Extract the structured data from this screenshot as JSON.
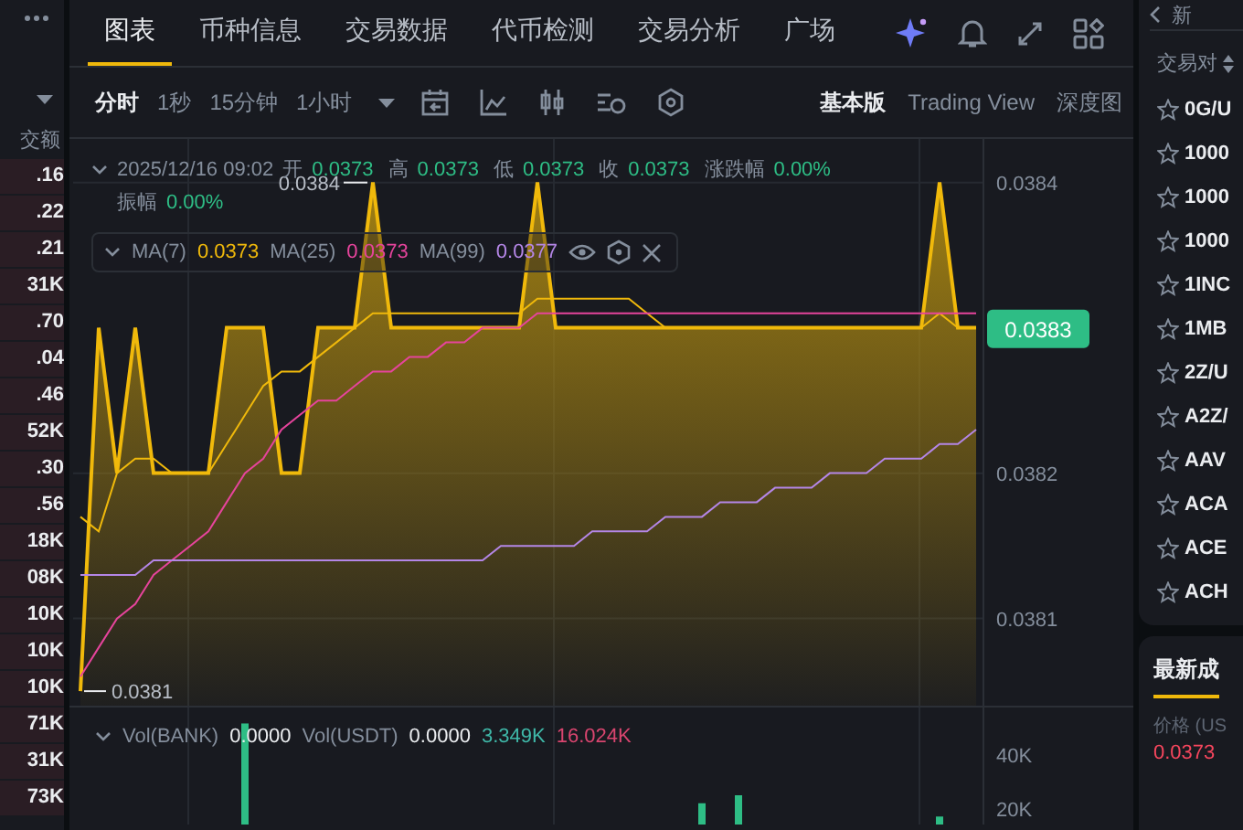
{
  "left_panel": {
    "header": "交额",
    "values": [
      ".16",
      ".22",
      ".21",
      "31K",
      ".70",
      ".04",
      ".46",
      "52K",
      ".30",
      ".56",
      "18K",
      "08K",
      "10K",
      "10K",
      "10K",
      "71K",
      "31K",
      "73K"
    ]
  },
  "tabs": [
    {
      "label": "图表",
      "selected": true
    },
    {
      "label": "币种信息",
      "selected": false
    },
    {
      "label": "交易数据",
      "selected": false
    },
    {
      "label": "代币检测",
      "selected": false
    },
    {
      "label": "交易分析",
      "selected": false
    },
    {
      "label": "广场",
      "selected": false
    }
  ],
  "intervals": [
    {
      "label": "分时",
      "selected": true
    },
    {
      "label": "1秒",
      "selected": false
    },
    {
      "label": "15分钟",
      "selected": false
    },
    {
      "label": "1小时",
      "selected": false
    }
  ],
  "views": [
    {
      "label": "基本版",
      "selected": true
    },
    {
      "label": "Trading View",
      "selected": false
    },
    {
      "label": "深度图",
      "selected": false
    }
  ],
  "ohlc": {
    "datetime": "2025/12/16 09:02",
    "rows": [
      [
        {
          "label": "开",
          "value": "0.0373"
        },
        {
          "label": "高",
          "value": "0.0373"
        },
        {
          "label": "低",
          "value": "0.0373"
        },
        {
          "label": "收",
          "value": "0.0373"
        },
        {
          "label": "涨跌幅",
          "value": "0.00%"
        }
      ],
      [
        {
          "label": "振幅",
          "value": "0.00%"
        }
      ]
    ]
  },
  "ma_legend": [
    {
      "value": "0.0373"
    },
    {
      "value": "0.0373"
    },
    {
      "value": "0.0377"
    }
  ],
  "price_chart": {
    "last_price": "0.0383",
    "chart_data": {
      "type": "line",
      "grid": true,
      "ylim": [
        0.03804,
        0.03843
      ],
      "yticks": [
        0.0381,
        0.0382,
        0.0384
      ],
      "series": [
        {
          "type": "area",
          "color": "#f0b90b",
          "values": [
            0.03805,
            0.0383,
            0.0382,
            0.0383,
            0.0382,
            0.0382,
            0.0382,
            0.0382,
            0.0383,
            0.0383,
            0.0383,
            0.0382,
            0.0382,
            0.0383,
            0.0383,
            0.0383,
            0.0384,
            0.0383,
            0.0383,
            0.0383,
            0.0383,
            0.0383,
            0.0383,
            0.0383,
            0.0383,
            0.0384,
            0.0383,
            0.0383,
            0.0383,
            0.0383,
            0.0383,
            0.0383,
            0.0383,
            0.0383,
            0.0383,
            0.0383,
            0.0383,
            0.0383,
            0.0383,
            0.0383,
            0.0383,
            0.0383,
            0.0383,
            0.0383,
            0.0383,
            0.0383,
            0.0383,
            0.0384,
            0.0383,
            0.0383
          ]
        },
        {
          "type": "line",
          "name": "MA(7)",
          "color": "#f0b90b",
          "values": [
            0.03817,
            0.03816,
            0.0382,
            0.03821,
            0.03821,
            0.0382,
            0.0382,
            0.0382,
            0.03822,
            0.03824,
            0.03826,
            0.03827,
            0.03827,
            0.03828,
            0.03829,
            0.0383,
            0.03831,
            0.03831,
            0.03831,
            0.03831,
            0.03831,
            0.03831,
            0.03831,
            0.03831,
            0.03831,
            0.03832,
            0.03832,
            0.03832,
            0.03832,
            0.03832,
            0.03832,
            0.03831,
            0.0383,
            0.0383,
            0.0383,
            0.0383,
            0.0383,
            0.0383,
            0.0383,
            0.0383,
            0.0383,
            0.0383,
            0.0383,
            0.0383,
            0.0383,
            0.0383,
            0.0383,
            0.03831,
            0.0383,
            0.0383
          ]
        },
        {
          "type": "line",
          "name": "MA(25)",
          "color": "#e6449c",
          "values": [
            0.03806,
            0.03808,
            0.0381,
            0.03811,
            0.03813,
            0.03814,
            0.03815,
            0.03816,
            0.03818,
            0.0382,
            0.03821,
            0.03823,
            0.03824,
            0.03825,
            0.03825,
            0.03826,
            0.03827,
            0.03827,
            0.03828,
            0.03828,
            0.03829,
            0.03829,
            0.0383,
            0.0383,
            0.0383,
            0.03831,
            0.03831,
            0.03831,
            0.03831,
            0.03831,
            0.03831,
            0.03831,
            0.03831,
            0.03831,
            0.03831,
            0.03831,
            0.03831,
            0.03831,
            0.03831,
            0.03831,
            0.03831,
            0.03831,
            0.03831,
            0.03831,
            0.03831,
            0.03831,
            0.03831,
            0.03831,
            0.03831,
            0.03831
          ]
        },
        {
          "type": "line",
          "name": "MA(99)",
          "color": "#b486e6",
          "values": [
            0.03813,
            0.03813,
            0.03813,
            0.03813,
            0.03814,
            0.03814,
            0.03814,
            0.03814,
            0.03814,
            0.03814,
            0.03814,
            0.03814,
            0.03814,
            0.03814,
            0.03814,
            0.03814,
            0.03814,
            0.03814,
            0.03814,
            0.03814,
            0.03814,
            0.03814,
            0.03814,
            0.03815,
            0.03815,
            0.03815,
            0.03815,
            0.03815,
            0.03816,
            0.03816,
            0.03816,
            0.03816,
            0.03817,
            0.03817,
            0.03817,
            0.03818,
            0.03818,
            0.03818,
            0.03819,
            0.03819,
            0.03819,
            0.0382,
            0.0382,
            0.0382,
            0.03821,
            0.03821,
            0.03821,
            0.03822,
            0.03822,
            0.03823
          ]
        }
      ],
      "annotations": [
        "0.0384",
        "0.0381"
      ]
    }
  },
  "volume": {
    "legend": [
      {
        "label": "Vol(BANK)",
        "value": "0.0000",
        "color": "#eaecef"
      },
      {
        "label": "Vol(USDT)",
        "value": "0.0000",
        "color": "#eaecef"
      },
      {
        "value": "3.349K",
        "color": "#3fb8a8"
      },
      {
        "value": "16.024K",
        "color": "#d9456f"
      }
    ],
    "chart_data": {
      "type": "bar",
      "grid": true,
      "ylim": [
        14000,
        58000
      ],
      "yticks": [
        {
          "value": 20000,
          "label": "20K"
        },
        {
          "value": 40000,
          "label": "40K"
        }
      ],
      "series": [
        {
          "color": "#2ebd85",
          "values": [
            null,
            null,
            null,
            null,
            null,
            null,
            null,
            null,
            null,
            52000,
            null,
            null,
            null,
            null,
            null,
            null,
            null,
            null,
            null,
            null,
            null,
            null,
            null,
            null,
            null,
            null,
            null,
            null,
            null,
            null,
            null,
            null,
            null,
            null,
            22000,
            null,
            25000,
            null,
            null,
            null,
            null,
            null,
            null,
            null,
            null,
            null,
            null,
            17000,
            null,
            null
          ]
        }
      ]
    }
  },
  "right_panel": {
    "title": "新",
    "column_label": "交易对",
    "pairs": [
      "0G/U",
      "1000",
      "1000",
      "1000",
      "1INC",
      "1MB",
      "2Z/U",
      "A2Z/",
      "AAV",
      "ACA",
      "ACE",
      "ACH"
    ],
    "trades_tab": "最新成",
    "price_label": "价格 (US",
    "price": "0.0373"
  }
}
